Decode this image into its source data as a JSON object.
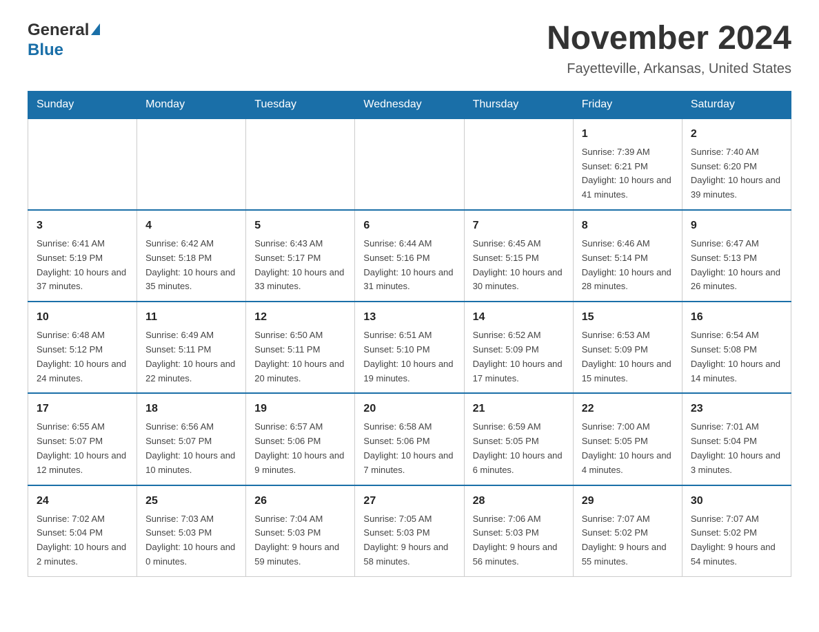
{
  "header": {
    "logo_text_general": "General",
    "logo_text_blue": "Blue",
    "title": "November 2024",
    "subtitle": "Fayetteville, Arkansas, United States"
  },
  "days_of_week": [
    "Sunday",
    "Monday",
    "Tuesday",
    "Wednesday",
    "Thursday",
    "Friday",
    "Saturday"
  ],
  "weeks": [
    [
      {
        "day": "",
        "info": ""
      },
      {
        "day": "",
        "info": ""
      },
      {
        "day": "",
        "info": ""
      },
      {
        "day": "",
        "info": ""
      },
      {
        "day": "",
        "info": ""
      },
      {
        "day": "1",
        "info": "Sunrise: 7:39 AM\nSunset: 6:21 PM\nDaylight: 10 hours and 41 minutes."
      },
      {
        "day": "2",
        "info": "Sunrise: 7:40 AM\nSunset: 6:20 PM\nDaylight: 10 hours and 39 minutes."
      }
    ],
    [
      {
        "day": "3",
        "info": "Sunrise: 6:41 AM\nSunset: 5:19 PM\nDaylight: 10 hours and 37 minutes."
      },
      {
        "day": "4",
        "info": "Sunrise: 6:42 AM\nSunset: 5:18 PM\nDaylight: 10 hours and 35 minutes."
      },
      {
        "day": "5",
        "info": "Sunrise: 6:43 AM\nSunset: 5:17 PM\nDaylight: 10 hours and 33 minutes."
      },
      {
        "day": "6",
        "info": "Sunrise: 6:44 AM\nSunset: 5:16 PM\nDaylight: 10 hours and 31 minutes."
      },
      {
        "day": "7",
        "info": "Sunrise: 6:45 AM\nSunset: 5:15 PM\nDaylight: 10 hours and 30 minutes."
      },
      {
        "day": "8",
        "info": "Sunrise: 6:46 AM\nSunset: 5:14 PM\nDaylight: 10 hours and 28 minutes."
      },
      {
        "day": "9",
        "info": "Sunrise: 6:47 AM\nSunset: 5:13 PM\nDaylight: 10 hours and 26 minutes."
      }
    ],
    [
      {
        "day": "10",
        "info": "Sunrise: 6:48 AM\nSunset: 5:12 PM\nDaylight: 10 hours and 24 minutes."
      },
      {
        "day": "11",
        "info": "Sunrise: 6:49 AM\nSunset: 5:11 PM\nDaylight: 10 hours and 22 minutes."
      },
      {
        "day": "12",
        "info": "Sunrise: 6:50 AM\nSunset: 5:11 PM\nDaylight: 10 hours and 20 minutes."
      },
      {
        "day": "13",
        "info": "Sunrise: 6:51 AM\nSunset: 5:10 PM\nDaylight: 10 hours and 19 minutes."
      },
      {
        "day": "14",
        "info": "Sunrise: 6:52 AM\nSunset: 5:09 PM\nDaylight: 10 hours and 17 minutes."
      },
      {
        "day": "15",
        "info": "Sunrise: 6:53 AM\nSunset: 5:09 PM\nDaylight: 10 hours and 15 minutes."
      },
      {
        "day": "16",
        "info": "Sunrise: 6:54 AM\nSunset: 5:08 PM\nDaylight: 10 hours and 14 minutes."
      }
    ],
    [
      {
        "day": "17",
        "info": "Sunrise: 6:55 AM\nSunset: 5:07 PM\nDaylight: 10 hours and 12 minutes."
      },
      {
        "day": "18",
        "info": "Sunrise: 6:56 AM\nSunset: 5:07 PM\nDaylight: 10 hours and 10 minutes."
      },
      {
        "day": "19",
        "info": "Sunrise: 6:57 AM\nSunset: 5:06 PM\nDaylight: 10 hours and 9 minutes."
      },
      {
        "day": "20",
        "info": "Sunrise: 6:58 AM\nSunset: 5:06 PM\nDaylight: 10 hours and 7 minutes."
      },
      {
        "day": "21",
        "info": "Sunrise: 6:59 AM\nSunset: 5:05 PM\nDaylight: 10 hours and 6 minutes."
      },
      {
        "day": "22",
        "info": "Sunrise: 7:00 AM\nSunset: 5:05 PM\nDaylight: 10 hours and 4 minutes."
      },
      {
        "day": "23",
        "info": "Sunrise: 7:01 AM\nSunset: 5:04 PM\nDaylight: 10 hours and 3 minutes."
      }
    ],
    [
      {
        "day": "24",
        "info": "Sunrise: 7:02 AM\nSunset: 5:04 PM\nDaylight: 10 hours and 2 minutes."
      },
      {
        "day": "25",
        "info": "Sunrise: 7:03 AM\nSunset: 5:03 PM\nDaylight: 10 hours and 0 minutes."
      },
      {
        "day": "26",
        "info": "Sunrise: 7:04 AM\nSunset: 5:03 PM\nDaylight: 9 hours and 59 minutes."
      },
      {
        "day": "27",
        "info": "Sunrise: 7:05 AM\nSunset: 5:03 PM\nDaylight: 9 hours and 58 minutes."
      },
      {
        "day": "28",
        "info": "Sunrise: 7:06 AM\nSunset: 5:03 PM\nDaylight: 9 hours and 56 minutes."
      },
      {
        "day": "29",
        "info": "Sunrise: 7:07 AM\nSunset: 5:02 PM\nDaylight: 9 hours and 55 minutes."
      },
      {
        "day": "30",
        "info": "Sunrise: 7:07 AM\nSunset: 5:02 PM\nDaylight: 9 hours and 54 minutes."
      }
    ]
  ]
}
